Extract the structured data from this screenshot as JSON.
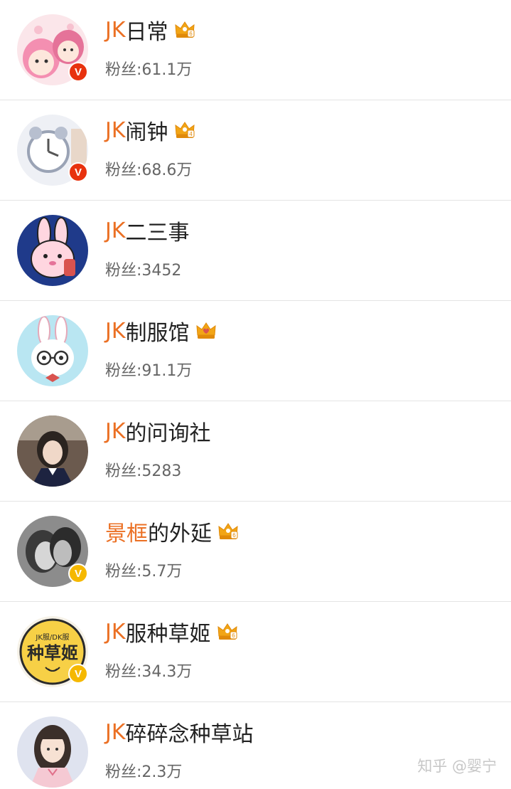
{
  "accounts": [
    {
      "highlight": "JK",
      "rest": "日常",
      "fans_label": "粉丝:",
      "fans": "61.1万",
      "crown": true,
      "crown_level": "6",
      "verify": "red"
    },
    {
      "highlight": "JK",
      "rest": "闹钟",
      "fans_label": "粉丝:",
      "fans": "68.6万",
      "crown": true,
      "crown_level": "4",
      "verify": "red"
    },
    {
      "highlight": "JK",
      "rest": "二三事",
      "fans_label": "粉丝:",
      "fans": "3452",
      "crown": false,
      "verify": "none"
    },
    {
      "highlight": "JK",
      "rest": "制服馆",
      "fans_label": "粉丝:",
      "fans": "91.1万",
      "crown": true,
      "crown_level": "",
      "verify": "none"
    },
    {
      "highlight": "JK",
      "rest": "的问询社",
      "fans_label": "粉丝:",
      "fans": "5283",
      "crown": false,
      "verify": "none"
    },
    {
      "highlight": "景框",
      "rest": "的外延",
      "fans_label": "粉丝:",
      "fans": "5.7万",
      "crown": true,
      "crown_level": "6",
      "verify": "gold"
    },
    {
      "highlight": "JK",
      "rest": "服种草姬",
      "fans_label": "粉丝:",
      "fans": "34.3万",
      "crown": true,
      "crown_level": "6",
      "verify": "gold"
    },
    {
      "highlight": "JK",
      "rest": "碎碎念种草站",
      "fans_label": "粉丝:",
      "fans": "2.3万",
      "crown": false,
      "verify": "none"
    }
  ],
  "avatar_text": {
    "zhongcaoji_top": "JK服/DK服",
    "zhongcaoji_main": "种草姬"
  },
  "verify_symbol": "V",
  "watermark": "知乎 @婴宁",
  "colors": {
    "highlight": "#eb7024",
    "name": "#222222",
    "fans": "#666666",
    "verify_red": "#e8320e",
    "verify_gold": "#f5b800",
    "crown": "#f2a516"
  }
}
